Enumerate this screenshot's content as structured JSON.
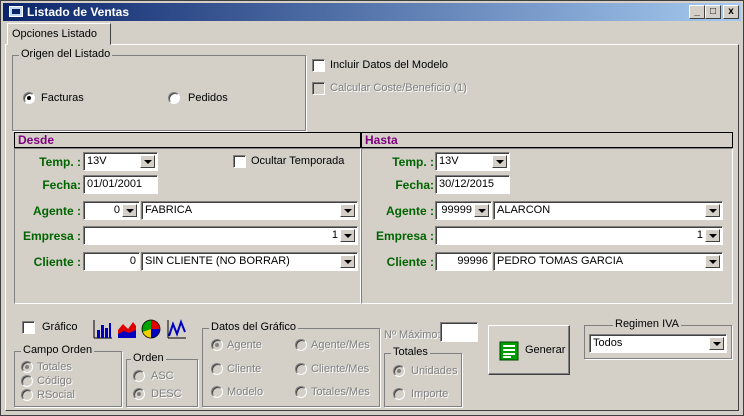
{
  "window": {
    "title": "Listado de Ventas",
    "buttons": [
      "_",
      "□",
      "x"
    ]
  },
  "tabs": [
    "Opciones Listado"
  ],
  "origen": {
    "legend": "Origen del Listado",
    "options": [
      {
        "label": "Facturas",
        "selected": true
      },
      {
        "label": "Pedidos",
        "selected": false
      }
    ]
  },
  "incluir_datos_modelo": {
    "label": "Incluir Datos del Modelo",
    "checked": false
  },
  "calcular_coste": {
    "label": "Calcular Coste/Beneficio (1)",
    "checked": false,
    "disabled": true
  },
  "desde": {
    "header": "Desde",
    "temp_label": "Temp. :",
    "temp_value": "13V",
    "ocultar_label": "Ocultar Temporada",
    "fecha_label": "Fecha:",
    "fecha_value": "01/01/2001",
    "agente_label": "Agente :",
    "agente_code": "0",
    "agente_name": "FABRICA",
    "empresa_label": "Empresa :",
    "empresa_value": "1",
    "cliente_label": "Cliente :",
    "cliente_code": "0",
    "cliente_name": "SIN CLIENTE (NO BORRAR)"
  },
  "hasta": {
    "header": "Hasta",
    "temp_label": "Temp. :",
    "temp_value": "13V",
    "fecha_label": "Fecha:",
    "fecha_value": "30/12/2015",
    "agente_label": "Agente :",
    "agente_code": "99999",
    "agente_name": "ALARCON",
    "empresa_label": "Empresa :",
    "empresa_value": "1",
    "cliente_label": "Cliente :",
    "cliente_code": "99996",
    "cliente_name": "PEDRO TOMAS GARCIA"
  },
  "grafico": {
    "label": "Gráfico",
    "checked": false
  },
  "campo_orden": {
    "legend": "Campo Orden",
    "options": [
      "Totales",
      "Código",
      "RSocial"
    ],
    "selected": 0
  },
  "orden": {
    "legend": "Orden",
    "options": [
      "ASC",
      "DESC"
    ],
    "selected": 1
  },
  "datos_grafico": {
    "legend": "Datos del Gráfico",
    "options": [
      "Agente",
      "Agente/Mes",
      "Cliente",
      "Cliente/Mes",
      "Modelo",
      "Totales/Mes"
    ],
    "selected": 0
  },
  "max": {
    "label": "Nº Máximo:",
    "value": ""
  },
  "totales": {
    "legend": "Totales",
    "options": [
      "Unidades",
      "Importe"
    ],
    "selected": 0
  },
  "generar": {
    "label": "Generar"
  },
  "regimen_iva": {
    "legend": "Regimen IVA",
    "value": "Todos"
  },
  "colors": {
    "title_start": "#0a246a",
    "title_end": "#a6caf0",
    "section_text": "#800080",
    "label_green": "#006400",
    "face": "#d4d0c8"
  },
  "icons": [
    "bar-chart-icon",
    "area-chart-icon",
    "pie-chart-icon",
    "line-chart-icon",
    "generar-icon"
  ]
}
